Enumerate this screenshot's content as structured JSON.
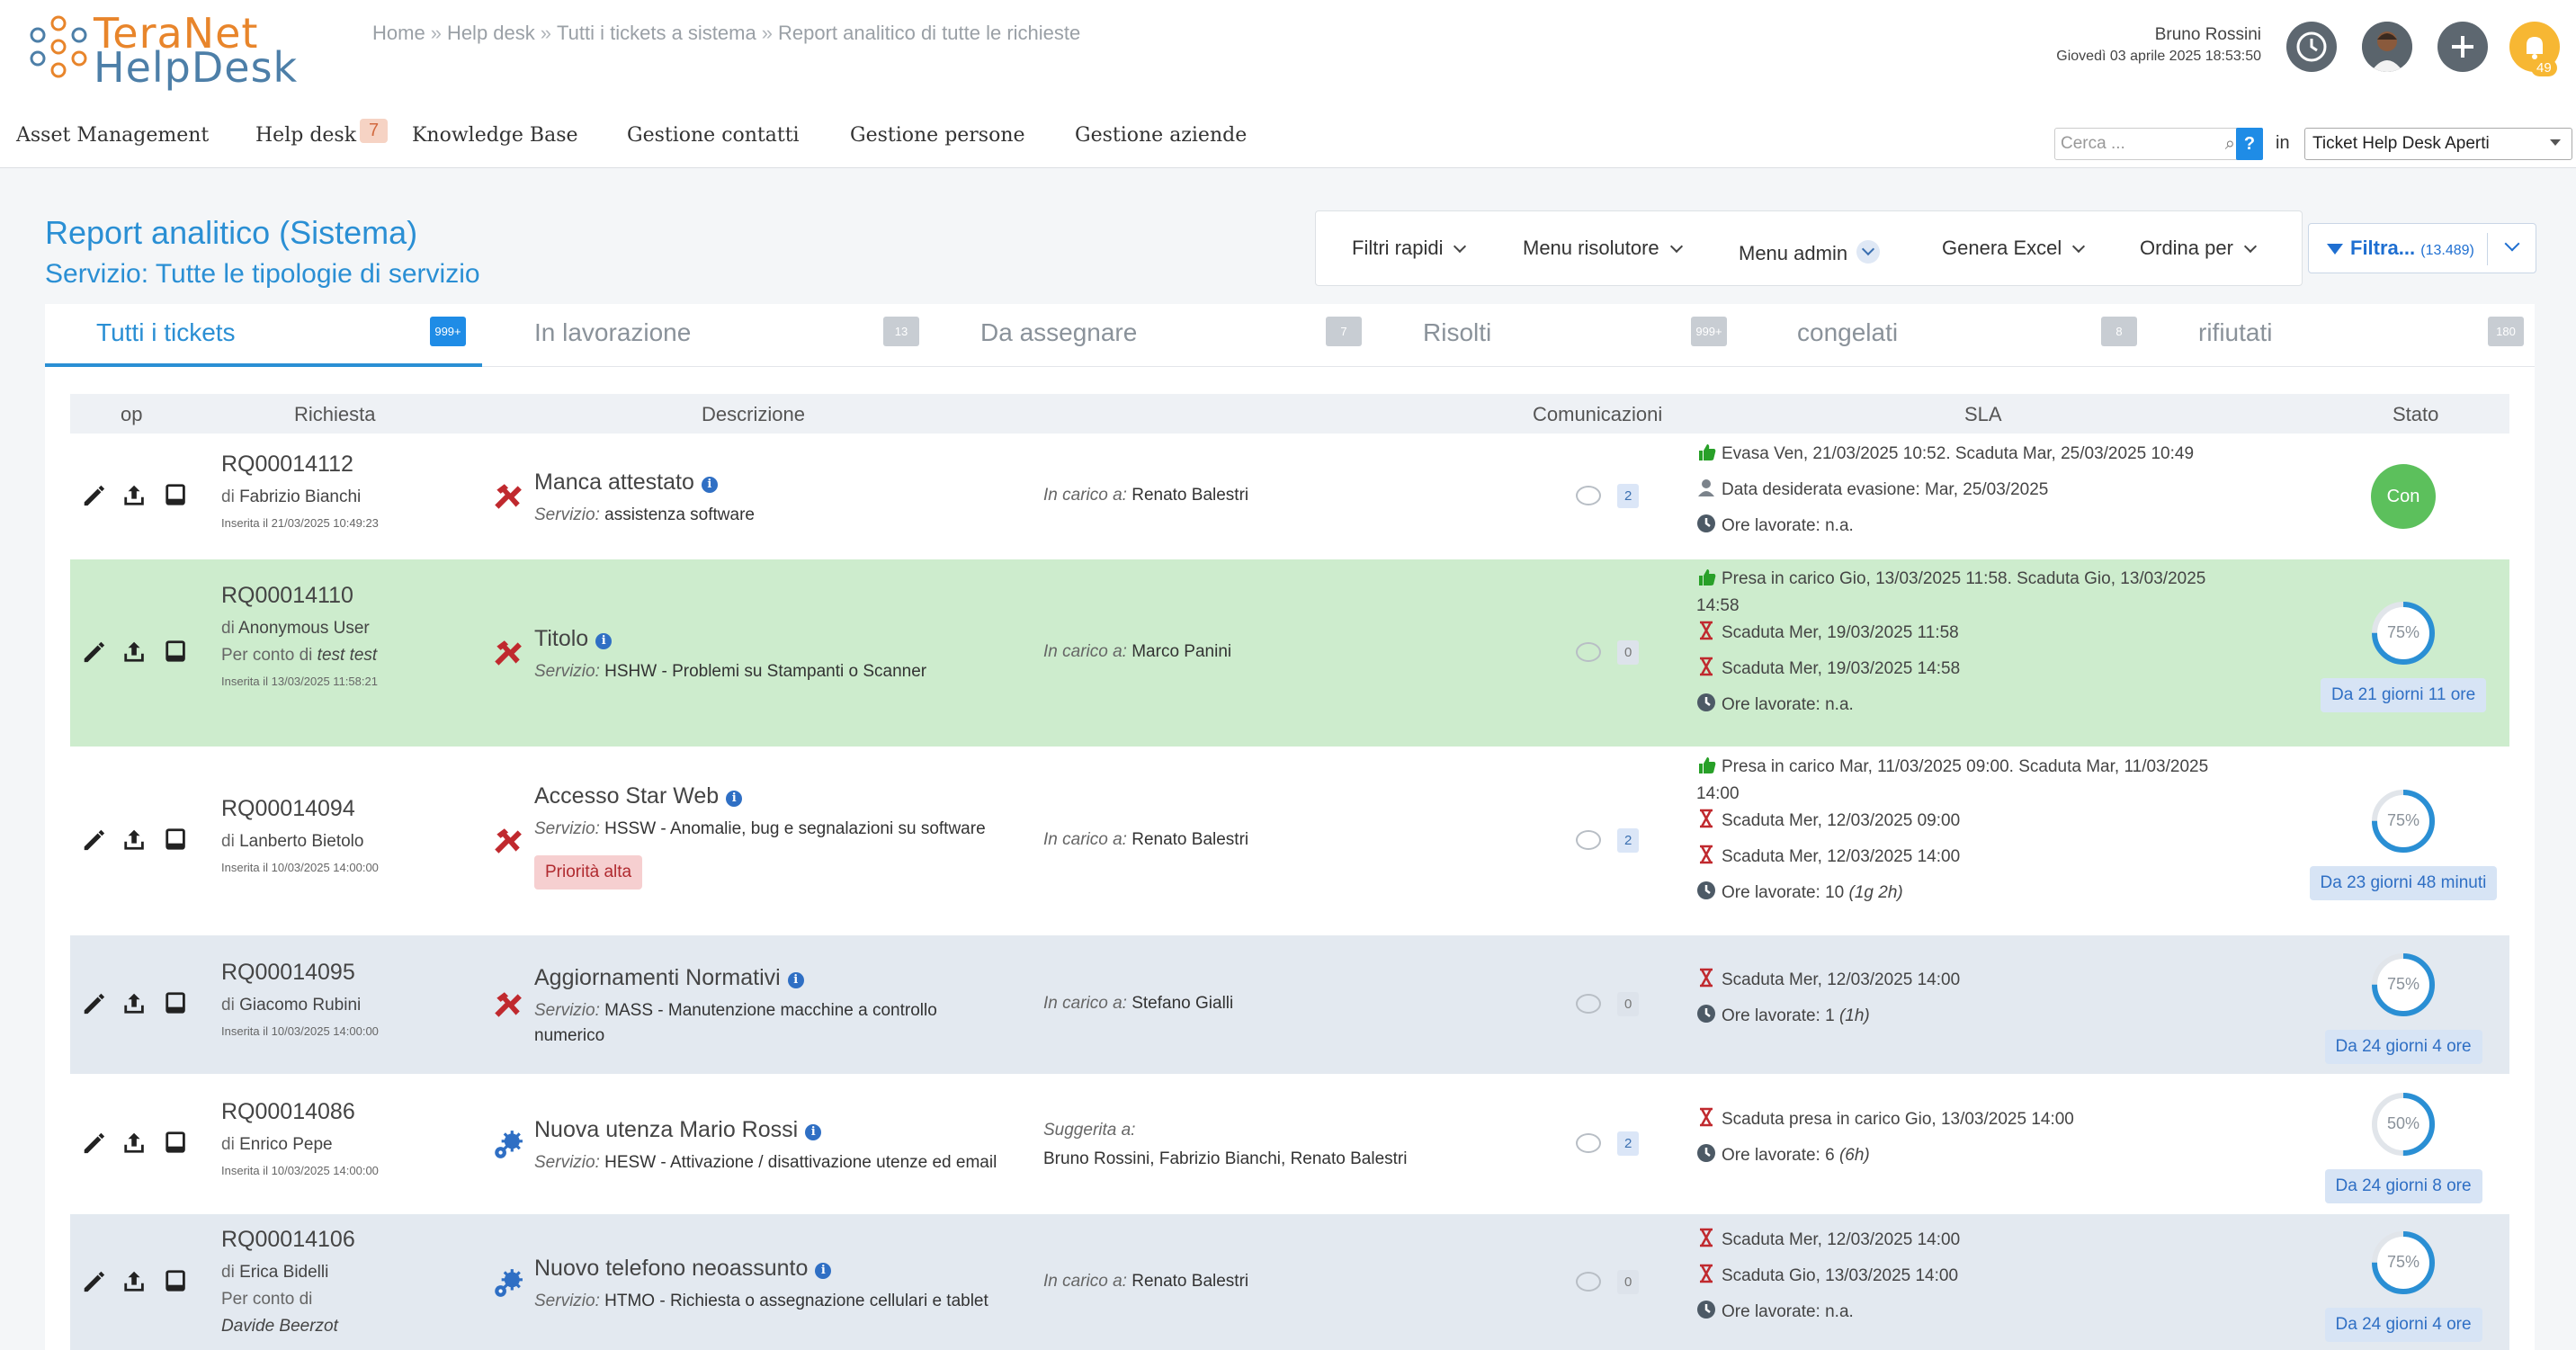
{
  "header": {
    "logo_line1": "TeraNet",
    "logo_line2": "HelpDesk",
    "breadcrumb": [
      "Home",
      "Help desk",
      "Tutti i tickets a sistema",
      "Report analitico di tutte le richieste"
    ],
    "user_name": "Bruno Rossini",
    "user_date": "Giovedì 03 aprile 2025 18:53:50",
    "notification_count": "49"
  },
  "nav": {
    "items": [
      "Asset Management",
      "Help desk",
      "Knowledge Base",
      "Gestione contatti",
      "Gestione persone",
      "Gestione aziende"
    ],
    "helpdesk_badge": "7",
    "search_placeholder": "Cerca ...",
    "help_label": "?",
    "in_label": "in",
    "scope_value": "Ticket Help Desk Aperti"
  },
  "page": {
    "title": "Report analitico (Sistema)",
    "subtitle": "Servizio: Tutte le tipologie di servizio"
  },
  "toolbar": {
    "items": [
      "Filtri rapidi",
      "Menu risolutore",
      "Menu admin",
      "Genera Excel",
      "Ordina per"
    ],
    "filter_label": "Filtra...",
    "filter_count": "(13.489)"
  },
  "tabs": [
    {
      "label": "Tutti i tickets",
      "badge": "999+"
    },
    {
      "label": "In lavorazione",
      "badge": "13"
    },
    {
      "label": "Da assegnare",
      "badge": "7"
    },
    {
      "label": "Risolti",
      "badge": "999+"
    },
    {
      "label": "congelati",
      "badge": "8"
    },
    {
      "label": "rifiutati",
      "badge": "180"
    }
  ],
  "table": {
    "headers": [
      "op",
      "Richiesta",
      "Descrizione",
      "Comunicazioni",
      "SLA",
      "Stato"
    ],
    "rows": [
      {
        "id": "RQ00014112",
        "by": "Fabrizio Bianchi",
        "on_behalf": "",
        "inserted": "Inserita il 21/03/2025 10:49:23",
        "title": "Manca attestato",
        "service": "assistenza software",
        "priority": "",
        "assign_label": "In carico a:",
        "assignee": "Renato Balestri",
        "comms": "2",
        "sla": [
          {
            "icon": "thumbs-up",
            "text": "Evasa Ven, 21/03/2025 10:52. Scaduta Mar, 25/03/2025 10:49"
          },
          {
            "icon": "person",
            "text": "Data desiderata evasione: Mar, 25/03/2025"
          },
          {
            "icon": "clock",
            "text": "Ore lavorate: n.a."
          }
        ],
        "status": "Con",
        "progress": "",
        "due": ""
      },
      {
        "id": "RQ00014110",
        "by": "Anonymous User",
        "on_behalf": "test test",
        "inserted": "Inserita il 13/03/2025 11:58:21",
        "title": "Titolo",
        "service": "HSHW - Problemi su Stampanti o Scanner",
        "priority": "",
        "assign_label": "In carico a:",
        "assignee": "Marco Panini",
        "comms": "0",
        "sla": [
          {
            "icon": "thumbs-up",
            "text": "Presa in carico Gio, 13/03/2025 11:58. Scaduta Gio, 13/03/2025"
          },
          {
            "icon": "",
            "text": "14:58"
          },
          {
            "icon": "hourglass",
            "text": "Scaduta Mer, 19/03/2025 11:58"
          },
          {
            "icon": "hourglass",
            "text": "Scaduta Mer, 19/03/2025 14:58"
          },
          {
            "icon": "clock",
            "text": "Ore lavorate: n.a."
          }
        ],
        "status": "",
        "progress": "75%",
        "due": "Da 21 giorni 11 ore"
      },
      {
        "id": "RQ00014094",
        "by": "Lanberto Bietolo",
        "on_behalf": "",
        "inserted": "Inserita il 10/03/2025 14:00:00",
        "title": "Accesso Star Web",
        "service": "HSSW - Anomalie, bug e segnalazioni su software",
        "priority": "Priorità alta",
        "assign_label": "In carico a:",
        "assignee": "Renato Balestri",
        "comms": "2",
        "sla": [
          {
            "icon": "thumbs-up",
            "text": "Presa in carico Mar, 11/03/2025 09:00. Scaduta Mar, 11/03/2025"
          },
          {
            "icon": "",
            "text": "14:00"
          },
          {
            "icon": "hourglass",
            "text": "Scaduta Mer, 12/03/2025 09:00"
          },
          {
            "icon": "hourglass",
            "text": "Scaduta Mer, 12/03/2025 14:00"
          },
          {
            "icon": "clock",
            "text": "Ore lavorate: 10",
            "extra": "(1g 2h)"
          }
        ],
        "status": "",
        "progress": "75%",
        "due": "Da 23 giorni 48 minuti"
      },
      {
        "id": "RQ00014095",
        "by": "Giacomo Rubini",
        "on_behalf": "",
        "inserted": "Inserita il 10/03/2025 14:00:00",
        "title": "Aggiornamenti Normativi",
        "service": "MASS - Manutenzione macchine a controllo",
        "service2": "numerico",
        "priority": "",
        "assign_label": "In carico a:",
        "assignee": "Stefano Gialli",
        "comms": "0",
        "sla": [
          {
            "icon": "hourglass",
            "text": "Scaduta Mer, 12/03/2025 14:00"
          },
          {
            "icon": "clock",
            "text": "Ore lavorate: 1",
            "extra": "(1h)"
          }
        ],
        "status": "",
        "progress": "75%",
        "due": "Da 24 giorni 4 ore"
      },
      {
        "id": "RQ00014086",
        "by": "Enrico Pepe",
        "on_behalf": "",
        "inserted": "Inserita il 10/03/2025 14:00:00",
        "title": "Nuova utenza Mario Rossi",
        "service": "HESW - Attivazione / disattivazione utenze ed email",
        "priority": "",
        "assign_label": "Suggerita a:",
        "assignee": "Bruno Rossini, Fabrizio Bianchi, Renato Balestri",
        "comms": "2",
        "sla": [
          {
            "icon": "hourglass",
            "text": "Scaduta presa in carico Gio, 13/03/2025 14:00"
          },
          {
            "icon": "clock",
            "text": "Ore lavorate: 6",
            "extra": "(6h)"
          }
        ],
        "status": "",
        "progress": "50%",
        "due": "Da 24 giorni 8 ore"
      },
      {
        "id": "RQ00014106",
        "by": "Erica Bidelli",
        "on_behalf": "Davide Beerzot",
        "inserted": "",
        "title": "Nuovo telefono neoassunto",
        "service": "HTMO - Richiesta o assegnazione cellulari e tablet",
        "priority": "",
        "assign_label": "In carico a:",
        "assignee": "Renato Balestri",
        "comms": "0",
        "sla": [
          {
            "icon": "hourglass",
            "text": "Scaduta Mer, 12/03/2025 14:00"
          },
          {
            "icon": "hourglass",
            "text": "Scaduta Gio, 13/03/2025 14:00"
          },
          {
            "icon": "clock",
            "text": "Ore lavorate: n.a."
          }
        ],
        "status": "",
        "progress": "75%",
        "due": "Da 24 giorni 4 ore"
      }
    ],
    "by_prefix": "di",
    "on_behalf_prefix": "Per conto di",
    "service_prefix": "Servizio:"
  },
  "colors": {
    "accent": "#2a8fd4",
    "row_green": "#cdeccd",
    "row_gray": "#e3e9f0",
    "status_done": "#5cc05c",
    "priority_high": "#b02a2f"
  }
}
